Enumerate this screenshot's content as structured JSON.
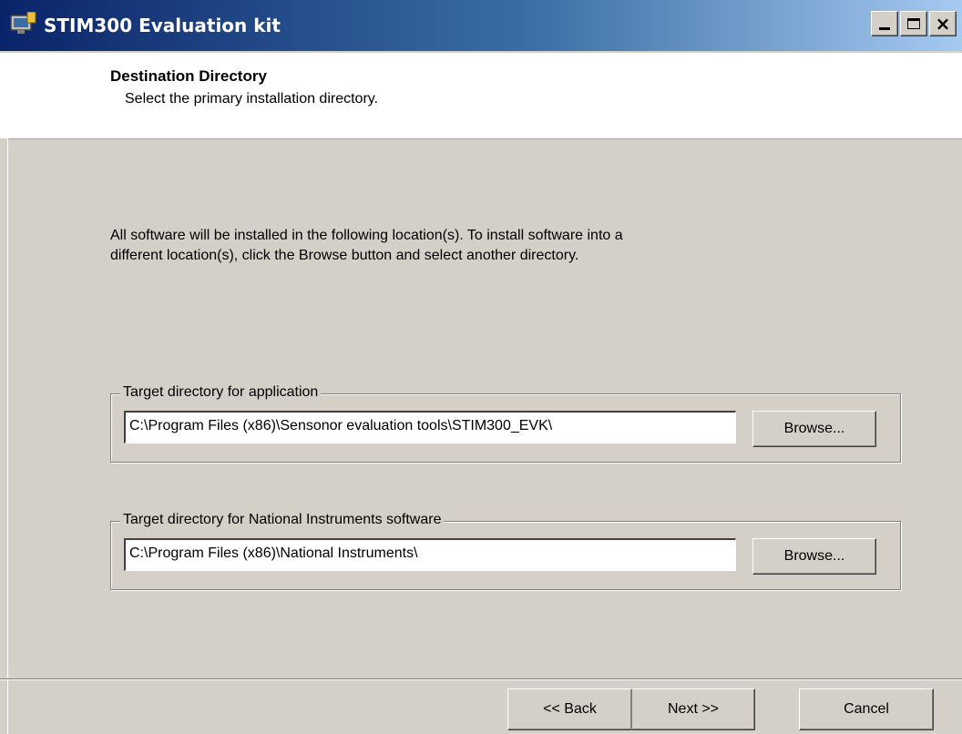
{
  "window": {
    "title": "STIM300 Evaluation kit",
    "icon": "installer-app-icon",
    "controls": {
      "minimize": "minimize-icon",
      "maximize": "maximize-icon",
      "close": "×"
    }
  },
  "header": {
    "title": "Destination Directory",
    "subtitle": "Select the primary installation directory."
  },
  "body": {
    "intro_line1": "All software will be installed in the following location(s). To install software into a",
    "intro_line2": "different location(s), click the Browse button and select another directory."
  },
  "groups": [
    {
      "legend": "Target directory for application",
      "path": "C:\\Program Files (x86)\\Sensonor evaluation tools\\STIM300_EVK\\",
      "browse_label": "Browse..."
    },
    {
      "legend": "Target directory for National Instruments software",
      "path": "C:\\Program Files (x86)\\National Instruments\\",
      "browse_label": "Browse..."
    }
  ],
  "footer": {
    "back_label": "<< Back",
    "next_label": "Next >>",
    "cancel_label": "Cancel"
  },
  "colors": {
    "dialog_bg": "#d4d0c8",
    "titlebar_start": "#0a246a",
    "titlebar_end": "#a6caf0"
  }
}
